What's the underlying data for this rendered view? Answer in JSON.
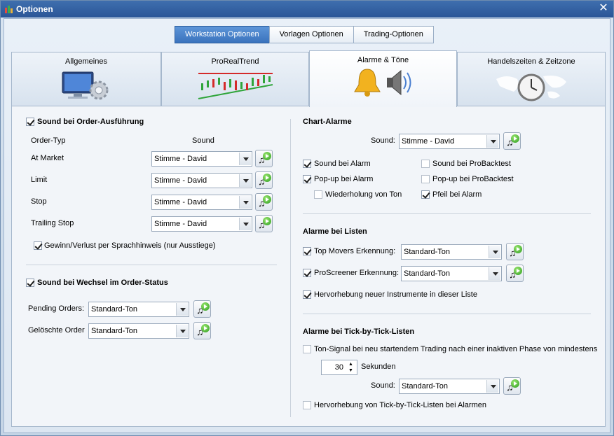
{
  "window": {
    "title": "Optionen"
  },
  "top_tabs": [
    "Workstation Optionen",
    "Vorlagen Optionen",
    "Trading-Optionen"
  ],
  "tabs": [
    "Allgemeines",
    "ProRealTrend",
    "Alarme & Töne",
    "Handelszeiten & Zeitzone"
  ],
  "left": {
    "order_exec": {
      "label": "Sound bei Order-Ausführung",
      "col_type": "Order-Typ",
      "col_sound": "Sound",
      "rows": [
        {
          "label": "At Market",
          "value": "Stimme - David"
        },
        {
          "label": "Limit",
          "value": "Stimme - David"
        },
        {
          "label": "Stop",
          "value": "Stimme - David"
        },
        {
          "label": "Trailing Stop",
          "value": "Stimme - David"
        }
      ],
      "gain_loss": "Gewinn/Verlust per Sprachhinweis (nur Ausstiege)"
    },
    "order_status": {
      "label": "Sound bei Wechsel im Order-Status",
      "rows": [
        {
          "label": "Pending Orders:",
          "value": "Standard-Ton"
        },
        {
          "label": "Gelöschte Order",
          "value": "Standard-Ton"
        }
      ]
    }
  },
  "right": {
    "chart_alarms": {
      "title": "Chart-Alarme",
      "sound_label": "Sound:",
      "sound_value": "Stimme - David",
      "sound_alarm": "Sound bei Alarm",
      "popup_alarm": "Pop-up bei Alarm",
      "repeat": "Wiederholung von Ton",
      "sound_backtest": "Sound bei ProBacktest",
      "popup_backtest": "Pop-up bei ProBacktest",
      "arrow_alarm": "Pfeil bei Alarm"
    },
    "list_alarms": {
      "title": "Alarme bei Listen",
      "top_movers": "Top Movers Erkennung:",
      "top_movers_value": "Standard-Ton",
      "proscreener": "ProScreener Erkennung:",
      "proscreener_value": "Standard-Ton",
      "highlight": "Hervorhebung neuer Instrumente in dieser Liste"
    },
    "tick_alarms": {
      "title": "Alarme bei Tick-by-Tick-Listen",
      "signal": "Ton-Signal bei neu startendem Trading nach einer inaktiven Phase von mindestens",
      "seconds_value": "30",
      "seconds_label": "Sekunden",
      "sound_label": "Sound:",
      "sound_value": "Standard-Ton",
      "highlight": "Hervorhebung von Tick-by-Tick-Listen bei Alarmen"
    }
  }
}
